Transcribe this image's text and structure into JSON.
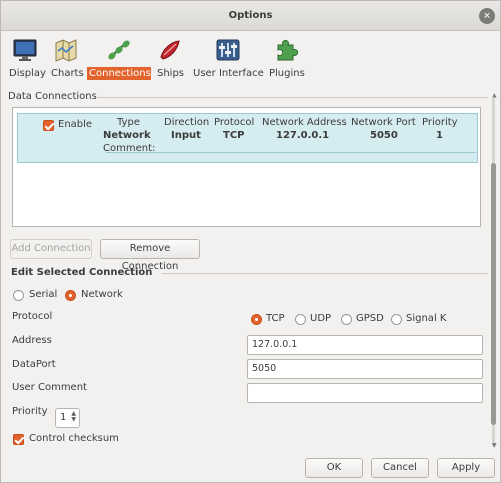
{
  "window": {
    "title": "Options",
    "close_glyph": "×"
  },
  "toolbar": {
    "items": [
      {
        "label": "Display",
        "icon": "monitor-icon"
      },
      {
        "label": "Charts",
        "icon": "charts-icon"
      },
      {
        "label": "Connections",
        "icon": "connections-icon",
        "active": true
      },
      {
        "label": "Ships",
        "icon": "ship-icon"
      },
      {
        "label": "User Interface",
        "icon": "user-interface-icon"
      },
      {
        "label": "Plugins",
        "icon": "plugins-icon"
      }
    ]
  },
  "data_connections": {
    "title": "Data Connections",
    "headers": {
      "enable": "Enable",
      "type": "Type",
      "direction": "Direction",
      "protocol": "Protocol",
      "network_address": "Network Address",
      "network_port": "Network Port",
      "priority": "Priority"
    },
    "row": {
      "enabled": true,
      "type": "Network",
      "direction": "Input",
      "protocol": "TCP",
      "network_address": "127.0.0.1",
      "network_port": "5050",
      "priority": "1",
      "comment_label": "Comment:"
    },
    "add_button": "Add Connection",
    "remove_button": "Remove Connection"
  },
  "edit": {
    "title": "Edit Selected Connection",
    "source_options": [
      {
        "label": "Serial",
        "selected": false
      },
      {
        "label": "Network",
        "selected": true
      }
    ],
    "protocol_label": "Protocol",
    "protocol_options": [
      {
        "label": "TCP",
        "selected": true
      },
      {
        "label": "UDP",
        "selected": false
      },
      {
        "label": "GPSD",
        "selected": false
      },
      {
        "label": "Signal K",
        "selected": false
      }
    ],
    "address_label": "Address",
    "address_value": "127.0.0.1",
    "dataport_label": "DataPort",
    "dataport_value": "5050",
    "comment_label": "User Comment",
    "comment_value": "",
    "priority_label": "Priority",
    "priority_value": "1",
    "checksum_label": "Control checksum",
    "checksum_checked": true
  },
  "buttons": {
    "ok": "OK",
    "cancel": "Cancel",
    "apply": "Apply"
  },
  "colors": {
    "accent": "#e2632b",
    "selected_row": "#d5ecf0"
  }
}
